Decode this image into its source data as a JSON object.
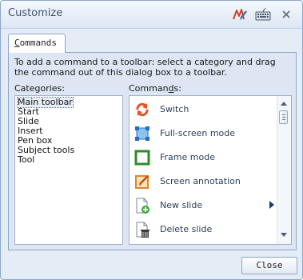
{
  "window": {
    "title": "Customize"
  },
  "titlebar_icons": [
    "pen-tool-icon",
    "keyboard-icon",
    "close-icon"
  ],
  "tabs": [
    {
      "label": "Commands",
      "selected": true
    }
  ],
  "instructions": "To add a command to a toolbar: select a category and drag the command out of this dialog box to a toolbar.",
  "categories": {
    "label": "Categories:",
    "items": [
      "Main toolbar",
      "Start",
      "Slide",
      "Insert",
      "Pen box",
      "Subject tools",
      "Tool"
    ],
    "selected": "Main toolbar"
  },
  "commands": {
    "label_before": "Comman",
    "label_accel": "d",
    "label_after": "s:",
    "items": [
      {
        "label": "Switch",
        "icon": "switch-icon"
      },
      {
        "label": "Full-screen mode",
        "icon": "fullscreen-icon"
      },
      {
        "label": "Frame mode",
        "icon": "frame-icon"
      },
      {
        "label": "Screen annotation",
        "icon": "annotation-icon"
      },
      {
        "label": "New slide",
        "icon": "new-slide-icon",
        "has_submenu": true
      },
      {
        "label": "Delete  slide",
        "icon": "delete-slide-icon"
      }
    ]
  },
  "buttons": {
    "close": "Close"
  },
  "colors": {
    "accent": "#8ea7c6",
    "panel": "#dde6f2",
    "title": "#3f546d"
  }
}
